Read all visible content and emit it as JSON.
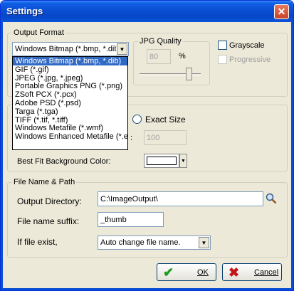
{
  "window": {
    "title": "Settings",
    "close_glyph": "✕"
  },
  "output_format": {
    "legend": "Output Format",
    "selected": "Windows Bitmap (*.bmp, *.dib)",
    "options": [
      "Windows Bitmap (*.bmp, *.dib)",
      "GIF (*.gif)",
      "JPEG (*.jpg, *.jpeg)",
      "Portable Graphics PNG (*.png)",
      "ZSoft PCX (*.pcx)",
      "Adobe PSD (*.psd)",
      "Targa (*.tga)",
      "TIFF (*.tif, *.tiff)",
      "Windows Metafile (*.wmf)",
      "Windows Enhanced Metafile (*.emf)"
    ],
    "jpg_quality_label": "JPG Quality",
    "jpg_quality_value": "80",
    "jpg_quality_unit": "%",
    "slider_level_fraction": 0.8,
    "grayscale_label": "Grayscale",
    "progressive_label": "Progressive"
  },
  "size": {
    "exact_size_label": "Exact Size",
    "height_value": "100",
    "colon": ":",
    "best_fit_bg_label": "Best Fit Background Color:",
    "bg_color": "#ffffff"
  },
  "file": {
    "legend": "File Name & Path",
    "output_dir_label": "Output Directory:",
    "output_dir_value": "C:\\ImageOutput\\",
    "suffix_label": "File name suffix:",
    "suffix_value": "_thumb",
    "exists_label": "If file exist,",
    "exists_value": "Auto change file name."
  },
  "buttons": {
    "ok": "OK",
    "cancel": "Cancel"
  },
  "colors": {
    "selection": "#316AC5",
    "ok_icon": "#1E9A1E",
    "cancel_icon": "#C0181A"
  }
}
